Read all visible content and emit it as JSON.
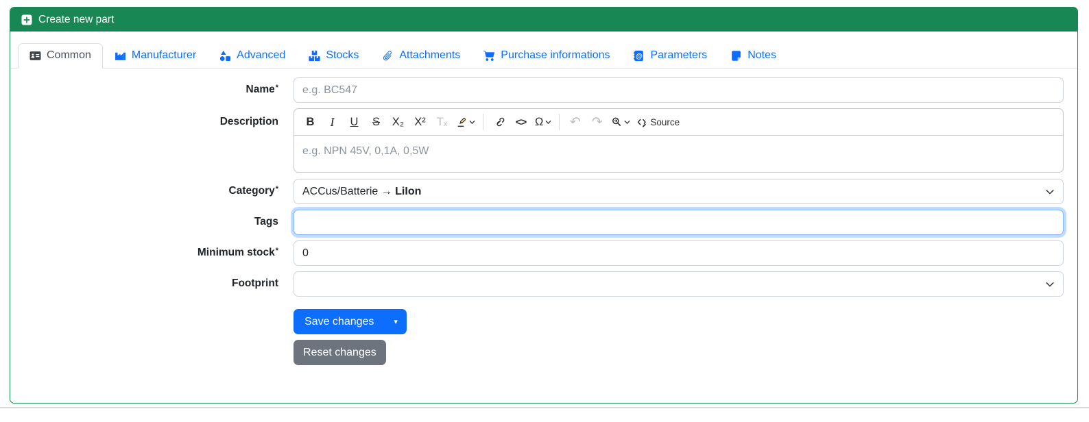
{
  "header": {
    "title": "Create new part"
  },
  "tabs": [
    {
      "label": "Common",
      "active": true
    },
    {
      "label": "Manufacturer",
      "active": false
    },
    {
      "label": "Advanced",
      "active": false
    },
    {
      "label": "Stocks",
      "active": false
    },
    {
      "label": "Attachments",
      "active": false
    },
    {
      "label": "Purchase informations",
      "active": false
    },
    {
      "label": "Parameters",
      "active": false
    },
    {
      "label": "Notes",
      "active": false
    }
  ],
  "form": {
    "required_marker": "*",
    "name": {
      "label": "Name",
      "placeholder": "e.g. BC547",
      "value": ""
    },
    "description": {
      "label": "Description",
      "placeholder": "e.g. NPN 45V, 0,1A, 0,5W",
      "value": "",
      "source_label": "Source",
      "toolbar_items": [
        "bold",
        "italic",
        "underline",
        "strikethrough",
        "subscript",
        "superscript",
        "remove-format",
        "highlight",
        "link",
        "code",
        "special-characters",
        "undo",
        "redo",
        "find-replace",
        "source"
      ]
    },
    "category": {
      "label": "Category",
      "value_prefix": "ACCus/Batterie → ",
      "value_bold": "LiIon"
    },
    "tags": {
      "label": "Tags",
      "value": "",
      "focused": true
    },
    "minimum_stock": {
      "label": "Minimum stock",
      "value": "0"
    },
    "footprint": {
      "label": "Footprint",
      "value": ""
    }
  },
  "buttons": {
    "save": "Save changes",
    "reset": "Reset changes"
  },
  "icons": {
    "bold": "B",
    "italic": "I",
    "underline": "U",
    "strikethrough": "S",
    "subscript": "X₂",
    "superscript": "X²",
    "remove_format": "Tₓ",
    "special_char": "Ω",
    "code": "<>",
    "undo": "↶",
    "redo": "↷",
    "caret": "▾"
  },
  "colors": {
    "header_green": "#198754",
    "link_blue": "#0d6efd",
    "save_blue": "#0d6efd",
    "reset_gray": "#6c757d",
    "focus_ring": "#86b7fe",
    "tab_border": "#dee2e6",
    "input_border": "#ced4da"
  }
}
